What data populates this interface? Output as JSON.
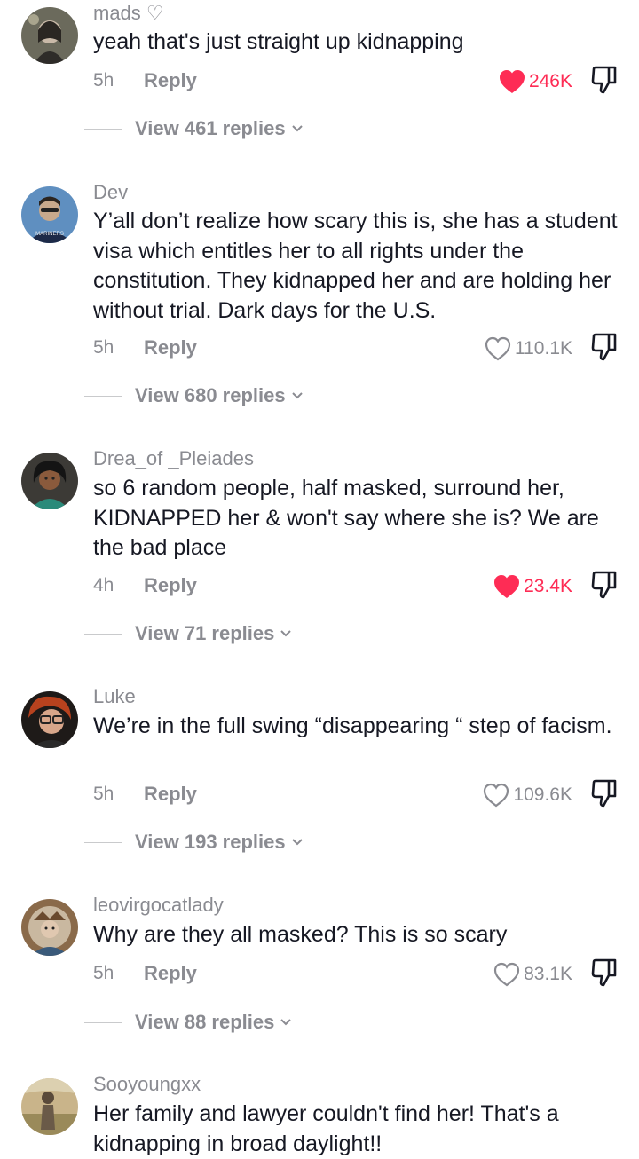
{
  "reply_label": "Reply",
  "colors": {
    "liked": "#fe2c55",
    "muted": "#8a8b91",
    "text": "#161823"
  },
  "comments": [
    {
      "username": "mads ♡",
      "text": "yeah that's just straight up kidnapping",
      "time": "5h",
      "likes": "246K",
      "liked": true,
      "view_replies": "View 461 replies"
    },
    {
      "username": "Dev",
      "text": "Y’all don’t realize how scary this is, she has a student visa which entitles her to all rights under the constitution. They kidnapped her and are holding her without trial. Dark days for the U.S.",
      "time": "5h",
      "likes": "110.1K",
      "liked": false,
      "view_replies": "View 680 replies"
    },
    {
      "username": "Drea_of _Pleiades",
      "text": "so 6 random people, half masked, surround her, KIDNAPPED her & won't say where she is? We are the bad place",
      "time": "4h",
      "likes": "23.4K",
      "liked": true,
      "view_replies": "View 71 replies"
    },
    {
      "username": "Luke",
      "text": "We’re in the full swing “disappearing “ step of facism.",
      "time": "5h",
      "likes": "109.6K",
      "liked": false,
      "view_replies": "View 193 replies"
    },
    {
      "username": "leovirgocatlady",
      "text": "Why are they all masked? This is so scary",
      "time": "5h",
      "likes": "83.1K",
      "liked": false,
      "view_replies": "View 88 replies"
    },
    {
      "username": "Sooyoungxx",
      "text": "Her family and lawyer couldn't find her! That's a kidnapping in broad daylight!!"
    }
  ]
}
